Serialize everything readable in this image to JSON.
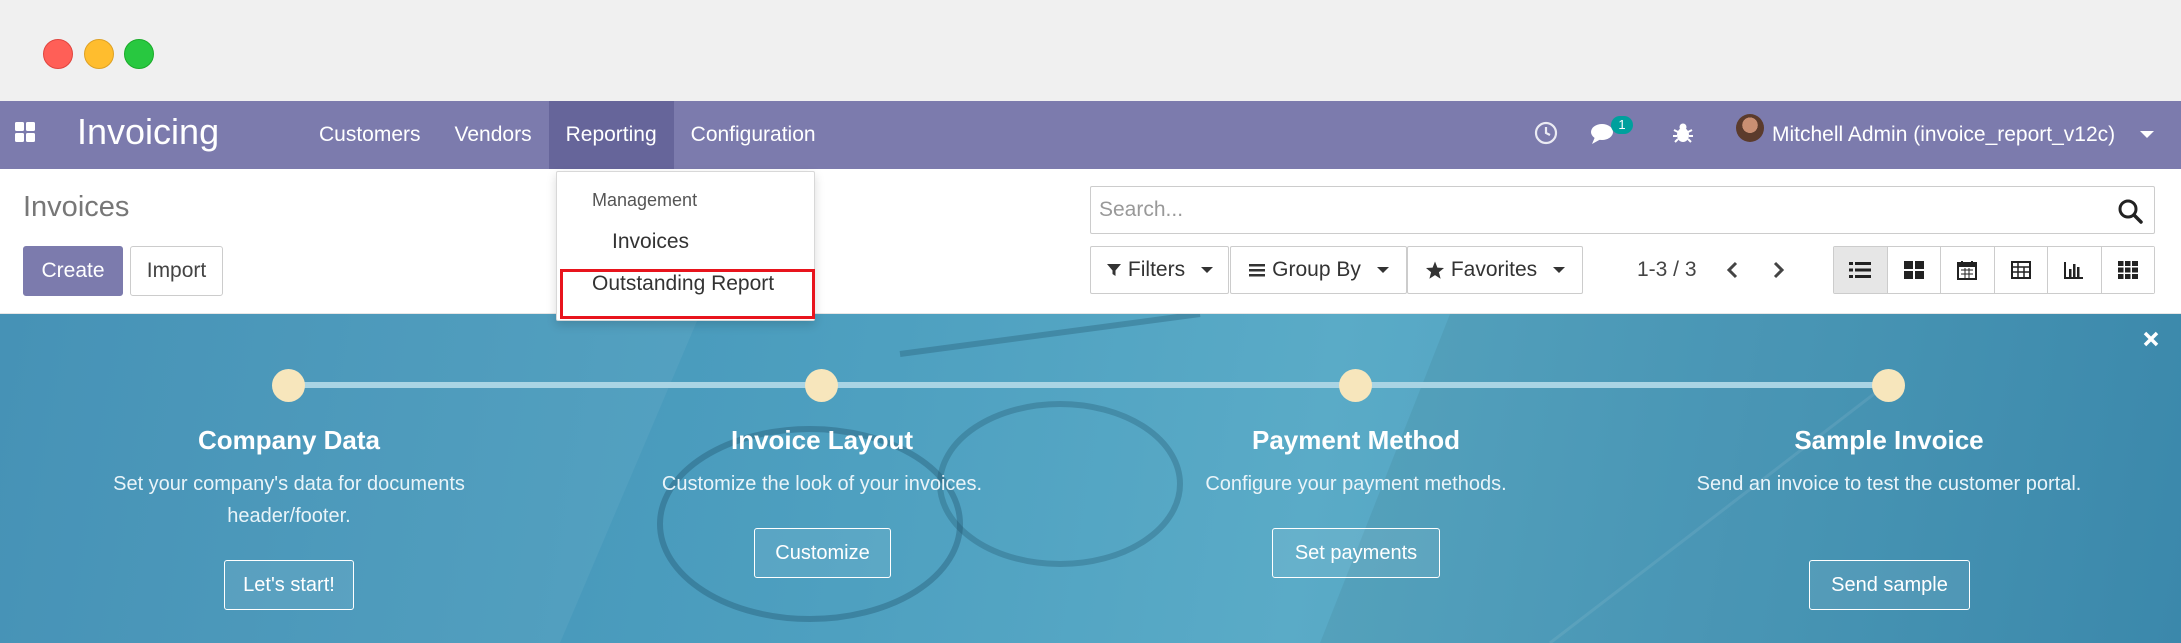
{
  "app": {
    "name": "Invoicing"
  },
  "nav": {
    "items": [
      {
        "label": "Customers",
        "active": false
      },
      {
        "label": "Vendors",
        "active": false
      },
      {
        "label": "Reporting",
        "active": true
      },
      {
        "label": "Configuration",
        "active": false
      }
    ],
    "chat_badge": "1",
    "user_name": "Mitchell Admin (invoice_report_v12c)"
  },
  "reporting_menu": {
    "header": "Management",
    "items": [
      "Invoices",
      "Outstanding Report"
    ]
  },
  "control": {
    "breadcrumb": "Invoices",
    "create_label": "Create",
    "import_label": "Import",
    "search_placeholder": "Search...",
    "filters_label": "Filters",
    "group_by_label": "Group By",
    "favorites_label": "Favorites",
    "pager": "1-3 / 3",
    "views": [
      "list-view-icon",
      "kanban-view-icon",
      "calendar-view-icon",
      "pivot-view-icon",
      "graph-view-icon",
      "grid-view-icon"
    ]
  },
  "onboarding": {
    "steps": [
      {
        "title": "Company Data",
        "description": "Set your company's data for documents header/footer.",
        "button": "Let's start!"
      },
      {
        "title": "Invoice Layout",
        "description": "Customize the look of your invoices.",
        "button": "Customize"
      },
      {
        "title": "Payment Method",
        "description": "Configure your payment methods.",
        "button": "Set payments"
      },
      {
        "title": "Sample Invoice",
        "description": "Send an invoice to test the customer portal.",
        "button": "Send sample"
      }
    ]
  },
  "colors": {
    "navbar": "#7c7bad",
    "primary_button": "#7c7bad",
    "banner": "#4ea0c0",
    "highlight": "#e8141d"
  }
}
